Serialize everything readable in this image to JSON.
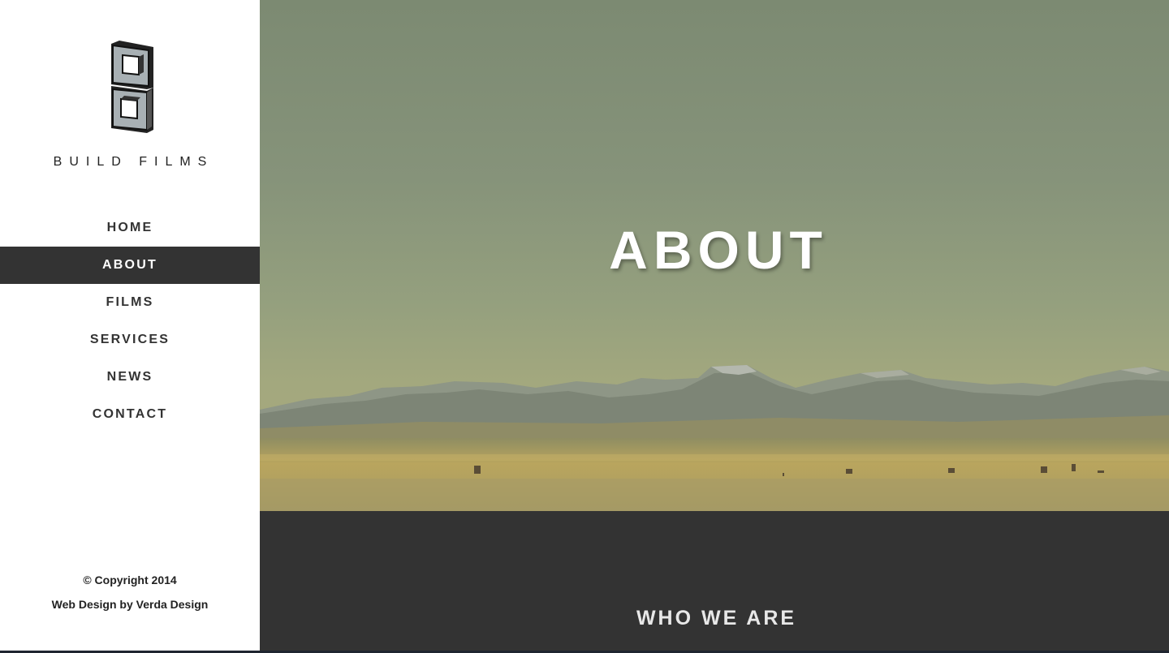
{
  "brand": {
    "name": "BUILD FILMS",
    "logo_icon": "build-films-logo-icon"
  },
  "nav": {
    "items": [
      {
        "label": "HOME",
        "active": false
      },
      {
        "label": "ABOUT",
        "active": true
      },
      {
        "label": "FILMS",
        "active": false
      },
      {
        "label": "SERVICES",
        "active": false
      },
      {
        "label": "NEWS",
        "active": false
      },
      {
        "label": "CONTACT",
        "active": false
      }
    ]
  },
  "footer": {
    "copyright": "© Copyright 2014",
    "credit": "Web Design by Verda Design"
  },
  "hero": {
    "title": "ABOUT"
  },
  "section": {
    "title": "WHO WE ARE"
  },
  "colors": {
    "nav_active_bg": "#333333",
    "section_bg": "#333333",
    "sidebar_bg": "#ffffff"
  }
}
